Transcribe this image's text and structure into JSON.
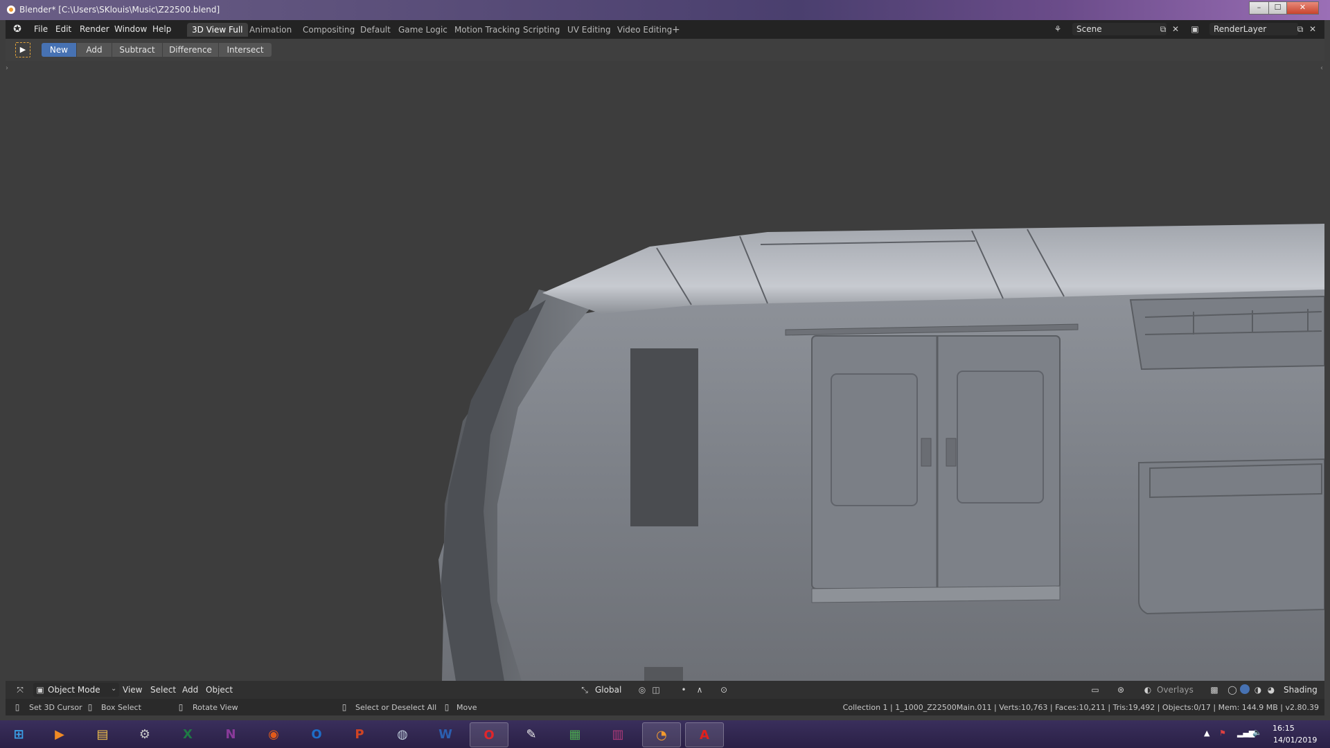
{
  "window": {
    "title": "Blender* [C:\\Users\\SKlouis\\Music\\Z22500.blend]",
    "controls": {
      "minimize": "–",
      "maximize": "☐",
      "close": "✕"
    }
  },
  "menu": [
    "File",
    "Edit",
    "Render",
    "Window",
    "Help"
  ],
  "workspaces": [
    "3D View Full",
    "Animation",
    "Compositing",
    "Default",
    "Game Logic",
    "Motion Tracking",
    "Scripting",
    "UV Editing",
    "Video Editing"
  ],
  "workspace_add": "+",
  "scene": {
    "name": "Scene"
  },
  "view_layer": {
    "name": "RenderLayer"
  },
  "tool_modes": [
    "New",
    "Add",
    "Subtract",
    "Difference",
    "Intersect"
  ],
  "viewport_header": {
    "mode": "Object Mode",
    "menus": [
      "View",
      "Select",
      "Add",
      "Object"
    ],
    "orientation": "Global",
    "overlays": "Overlays",
    "shading": "Shading"
  },
  "statusbar": {
    "hints": [
      "Set 3D Cursor",
      "Box Select",
      "Rotate View",
      "Select or Deselect All",
      "Move"
    ],
    "stats": "Collection 1 | 1_1000_Z22500Main.011 | Verts:10,763 | Faces:10,211 | Tris:19,492 | Objects:0/17 | Mem: 144.9 MB | v2.80.39"
  },
  "taskbar": {
    "apps": [
      {
        "name": "windows-start",
        "glyph": "⊞",
        "color": "#3aa0e8"
      },
      {
        "name": "media-player",
        "glyph": "▶",
        "color": "#f08a24"
      },
      {
        "name": "file-explorer",
        "glyph": "▤",
        "color": "#f3c24b"
      },
      {
        "name": "settings",
        "glyph": "⚙",
        "color": "#c8c8c8"
      },
      {
        "name": "excel",
        "glyph": "X",
        "color": "#1f7a45"
      },
      {
        "name": "onenote",
        "glyph": "N",
        "color": "#8a3a9a"
      },
      {
        "name": "game-app",
        "glyph": "◉",
        "color": "#e05a1a"
      },
      {
        "name": "outlook",
        "glyph": "O",
        "color": "#1e6ec8"
      },
      {
        "name": "powerpoint",
        "glyph": "P",
        "color": "#d04423"
      },
      {
        "name": "steam",
        "glyph": "◍",
        "color": "#b9c6d6"
      },
      {
        "name": "word",
        "glyph": "W",
        "color": "#2b5fb0"
      },
      {
        "name": "opera",
        "glyph": "O",
        "color": "#e0262b"
      },
      {
        "name": "paint",
        "glyph": "✎",
        "color": "#e8e8e8"
      },
      {
        "name": "monitor-app",
        "glyph": "▦",
        "color": "#4caf50"
      },
      {
        "name": "winrar",
        "glyph": "▥",
        "color": "#b03a7a"
      },
      {
        "name": "blender",
        "glyph": "◔",
        "color": "#f29a2e"
      },
      {
        "name": "acrobat",
        "glyph": "A",
        "color": "#e0201c"
      }
    ],
    "time": "16:15",
    "date": "14/01/2019"
  }
}
